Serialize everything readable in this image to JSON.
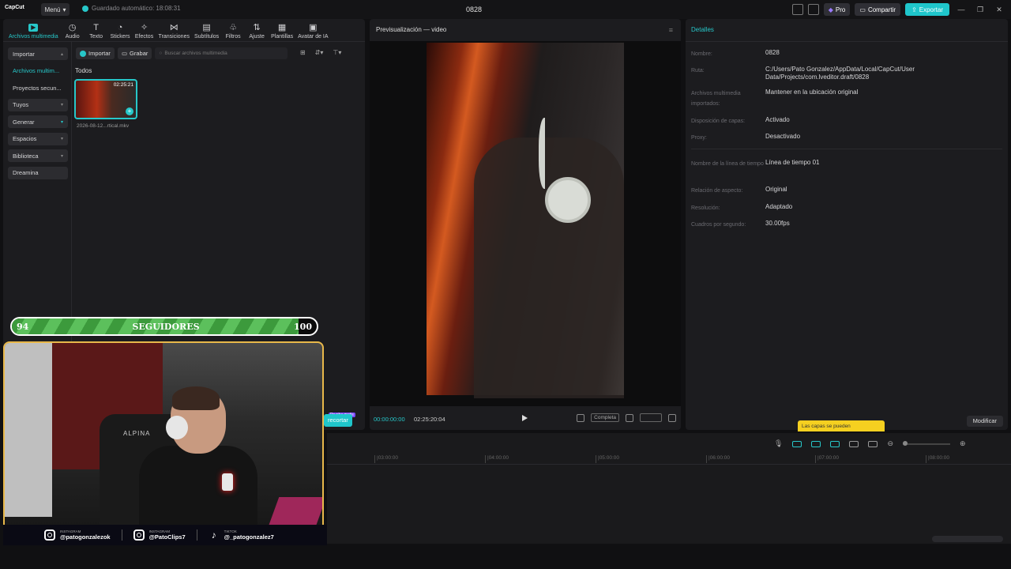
{
  "titlebar": {
    "app_logo": "CapCut",
    "menu_label": "Menú",
    "autosave": "Guardado automático: 18:08:31",
    "project_title": "0828",
    "pro_label": "Pro",
    "share_label": "Compartir",
    "export_label": "Exportar"
  },
  "tool_tabs": [
    {
      "label": "Archivos multimedia",
      "icon": "media-icon"
    },
    {
      "label": "Audio",
      "icon": "audio-icon"
    },
    {
      "label": "Texto",
      "icon": "text-icon"
    },
    {
      "label": "Stickers",
      "icon": "sticker-icon"
    },
    {
      "label": "Efectos",
      "icon": "effects-icon"
    },
    {
      "label": "Transiciones",
      "icon": "transitions-icon"
    },
    {
      "label": "Subtítulos",
      "icon": "subtitles-icon"
    },
    {
      "label": "Filtros",
      "icon": "filters-icon"
    },
    {
      "label": "Ajuste",
      "icon": "adjust-icon"
    },
    {
      "label": "Plantillas",
      "icon": "templates-icon"
    },
    {
      "label": "Avatar de IA",
      "icon": "ai-avatar-icon"
    }
  ],
  "sidebar": {
    "items": [
      {
        "label": "Importar"
      },
      {
        "label": "Archivos multim..."
      },
      {
        "label": "Proyectos secun..."
      },
      {
        "label": "Tuyos"
      },
      {
        "label": "Generar"
      },
      {
        "label": "Espacios"
      },
      {
        "label": "Biblioteca"
      },
      {
        "label": "Dreamina"
      }
    ]
  },
  "media": {
    "import_label": "Importar",
    "record_label": "Grabar",
    "search_placeholder": "Buscar archivos multimedia",
    "filter_label": "Todos",
    "clip_duration": "02:25:21",
    "clip_name": "2026-08-12...rtical.mkv"
  },
  "preview": {
    "title": "Previsualización — video",
    "current_time": "00:00:00:00",
    "total_time": "02:25:20:04",
    "full_label": "Completa"
  },
  "details": {
    "title": "Detalles",
    "rows": [
      {
        "key": "Nombre:",
        "value": "0828"
      },
      {
        "key": "Ruta:",
        "value": "C:/Users/Pato Gonzalez/AppData/Local/CapCut/User Data/Projects/com.lveditor.draft/0828"
      },
      {
        "key": "Archivos multimedia importados:",
        "value": "Mantener en la ubicación original"
      },
      {
        "key": "Disposición de capas:",
        "value": "Activado"
      },
      {
        "key": "Proxy:",
        "value": "Desactivado"
      },
      {
        "key": "Nombre de la línea de tiempo",
        "value": "Línea de tiempo 01"
      },
      {
        "key": "Relación de aspecto:",
        "value": "Original"
      },
      {
        "key": "Resolución:",
        "value": "Adaptado"
      },
      {
        "key": "Cuadros por segundo:",
        "value": "30.00fps"
      }
    ],
    "modify_label": "Modificar",
    "tip_text": "Las capas se pueden"
  },
  "timeline": {
    "ticks": [
      "|03:00:00",
      "|04:00:00",
      "|05:00:00",
      "|06:00:00",
      "|07:00:00",
      "|08:00:00"
    ]
  },
  "overlay": {
    "progress_min": "94",
    "progress_max": "100",
    "progress_label": "SEGUIDORES",
    "progress_fraction": 0.94,
    "recortar_label": "recortar",
    "recortar_tag": "Prueba gratis",
    "chair_brand": "ALPINA",
    "socials": [
      {
        "platform": "INSTAGRAM",
        "handle": "@patogonzalezok"
      },
      {
        "platform": "INSTAGRAM",
        "handle": "@PatoClips7"
      },
      {
        "platform": "TIKTOK",
        "handle": "@_patogonzalez7"
      }
    ]
  },
  "colors": {
    "accent": "#27c7c9",
    "progress_green": "#3c9a3c",
    "tip_yellow": "#f5d020"
  }
}
